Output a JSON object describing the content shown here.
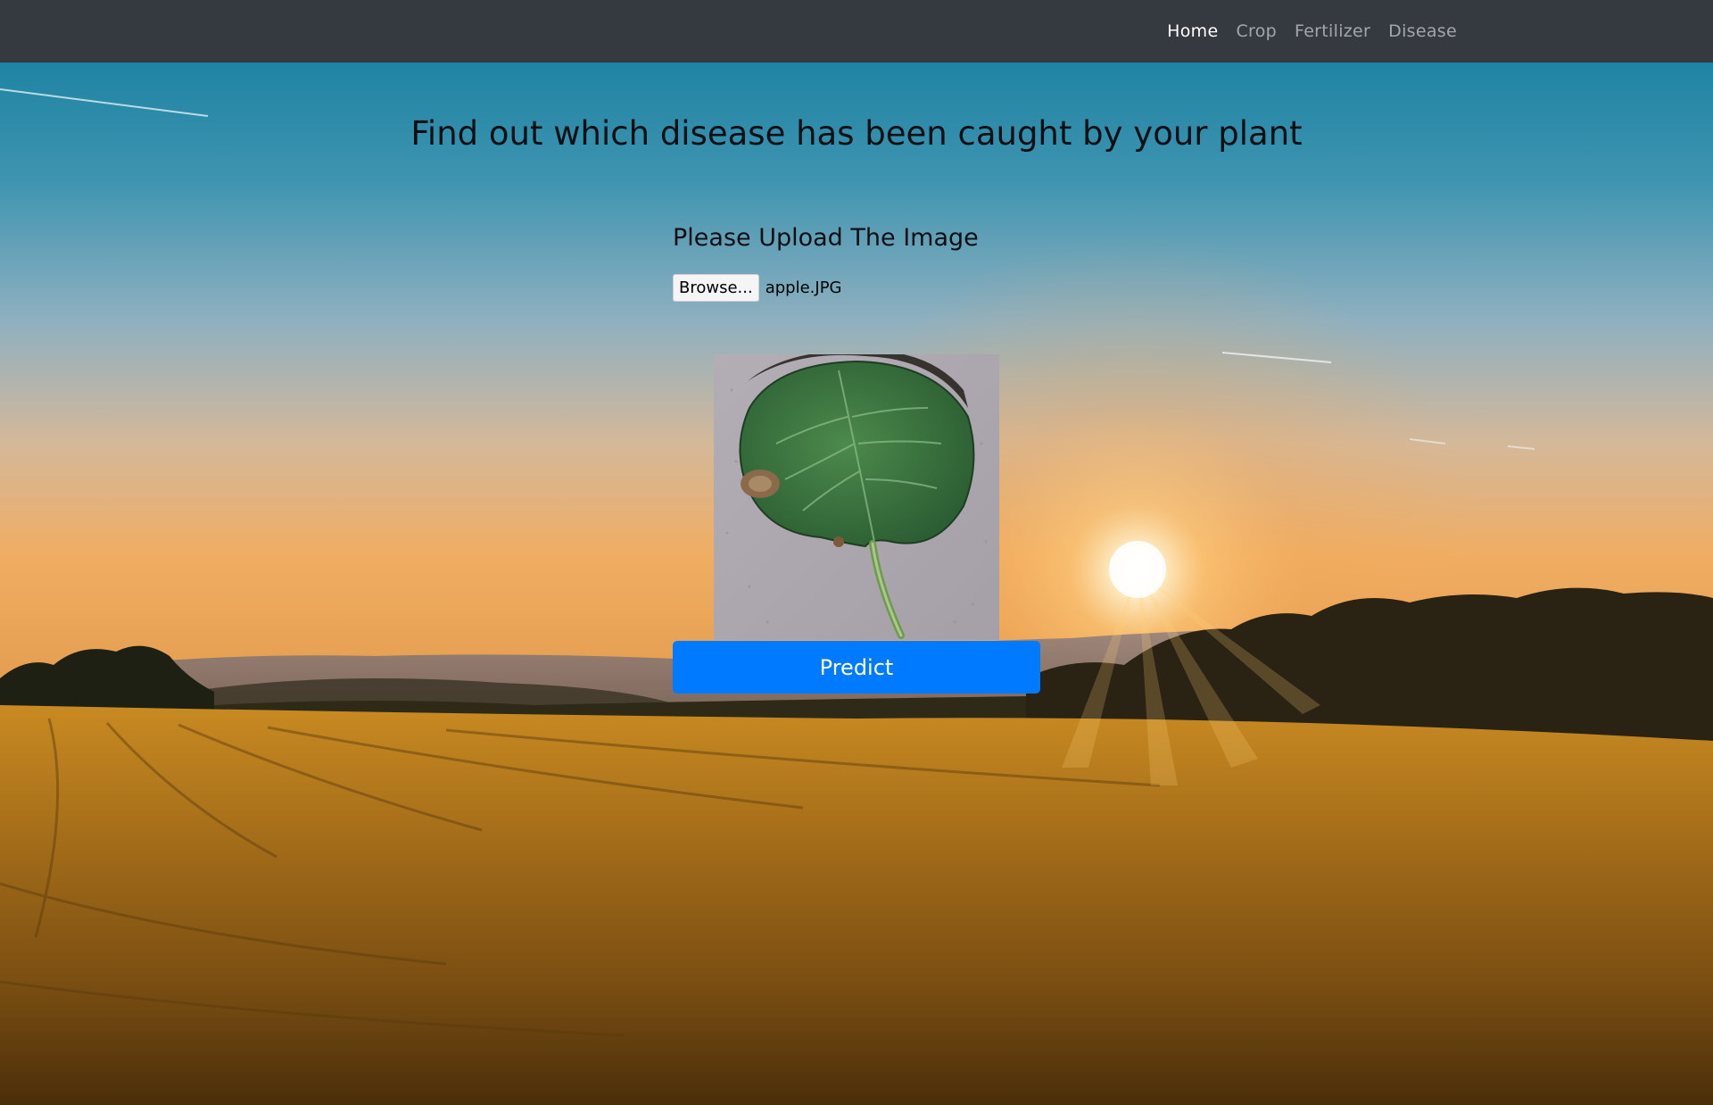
{
  "nav": {
    "items": [
      {
        "label": "Home",
        "active": true
      },
      {
        "label": "Crop",
        "active": false
      },
      {
        "label": "Fertilizer",
        "active": false
      },
      {
        "label": "Disease",
        "active": false
      }
    ]
  },
  "main": {
    "headline": "Find out which disease has been caught by your plant",
    "upload_label": "Please Upload The Image",
    "browse_label": "Browse...",
    "file_name": "apple.JPG",
    "predict_label": "Predict"
  },
  "colors": {
    "navbar": "#343a40",
    "primary": "#007bff"
  }
}
